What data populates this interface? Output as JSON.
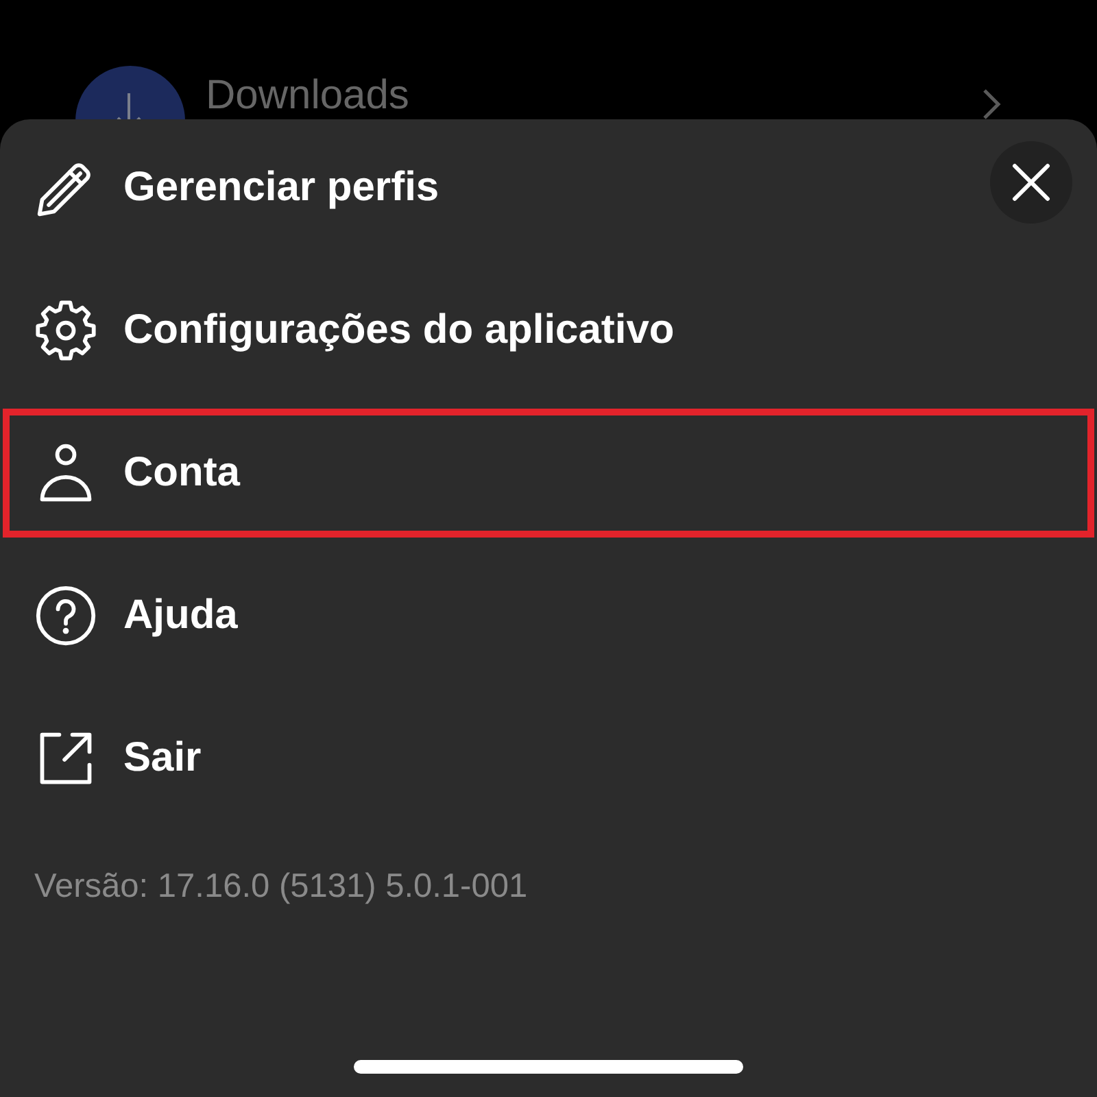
{
  "behind_row": {
    "label": "Downloads"
  },
  "menu": [
    {
      "label": "Gerenciar perfis",
      "highlighted": false
    },
    {
      "label": "Configurações do aplicativo",
      "highlighted": false
    },
    {
      "label": "Conta",
      "highlighted": true
    },
    {
      "label": "Ajuda",
      "highlighted": false
    },
    {
      "label": "Sair",
      "highlighted": false
    }
  ],
  "version": "Versão: 17.16.0 (5131) 5.0.1-001"
}
